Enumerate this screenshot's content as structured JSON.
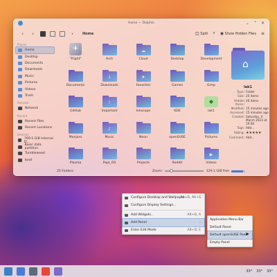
{
  "window": {
    "title": "Home — Dolphin",
    "controls": [
      "⌄",
      "⌃",
      "✕"
    ]
  },
  "toolbar": {
    "back": "‹",
    "forward": "›",
    "breadcrumb_arrow": "›",
    "breadcrumb": "Home",
    "split_label": "Split",
    "search_icon": "⌕",
    "show_hidden_label": "Show Hidden Files",
    "menu_icon": "≡"
  },
  "sidebar": {
    "places_header": "Places",
    "places": [
      {
        "label": "Home",
        "icon": "home-icon"
      },
      {
        "label": "Desktop",
        "icon": "desktop-icon"
      },
      {
        "label": "Documents",
        "icon": "documents-icon"
      },
      {
        "label": "Downloads",
        "icon": "downloads-icon"
      },
      {
        "label": "Music",
        "icon": "music-icon"
      },
      {
        "label": "Pictures",
        "icon": "pictures-icon"
      },
      {
        "label": "Videos",
        "icon": "videos-icon"
      },
      {
        "label": "Trash",
        "icon": "trash-icon"
      }
    ],
    "remote_header": "Remote",
    "remote": [
      {
        "label": "Network",
        "icon": "network-icon"
      }
    ],
    "recent_header": "Recent",
    "recent": [
      {
        "label": "Recent Files",
        "icon": "recent-files-icon"
      },
      {
        "label": "Recent Locations",
        "icon": "recent-locations-icon"
      }
    ],
    "devices_header": "Devices",
    "devices": [
      {
        "label": "769.5 GiB Internal D...",
        "icon": "drive-icon"
      },
      {
        "label": "Basic data partition",
        "icon": "drive-icon"
      },
      {
        "label": "Tumbleweed",
        "icon": "drive-icon"
      },
      {
        "label": "boot",
        "icon": "drive-icon"
      }
    ]
  },
  "files": [
    {
      "name": "\"Flight\"",
      "kind": "image"
    },
    {
      "name": "Arch",
      "kind": "folder",
      "glyph": ""
    },
    {
      "name": "Cloud",
      "kind": "folder",
      "glyph": "☁"
    },
    {
      "name": "Desktop",
      "kind": "folder",
      "glyph": ""
    },
    {
      "name": "Development",
      "kind": "folder",
      "glyph": ""
    },
    {
      "name": "Documents",
      "kind": "folder",
      "glyph": ""
    },
    {
      "name": "Downloads",
      "kind": "folder",
      "glyph": "↓"
    },
    {
      "name": "Favorites",
      "kind": "folder",
      "glyph": "★"
    },
    {
      "name": "Games",
      "kind": "folder",
      "glyph": ""
    },
    {
      "name": "Gimp",
      "kind": "folder",
      "glyph": ""
    },
    {
      "name": "GitHub",
      "kind": "folder",
      "glyph": ""
    },
    {
      "name": "Important",
      "kind": "folder",
      "glyph": "!"
    },
    {
      "name": "Inkscape",
      "kind": "folder",
      "glyph": ""
    },
    {
      "name": "KDE",
      "kind": "folder",
      "glyph": ""
    },
    {
      "name": "lak1",
      "kind": "ghost"
    },
    {
      "name": "Manjaro",
      "kind": "folder",
      "glyph": ""
    },
    {
      "name": "Music",
      "kind": "folder",
      "glyph": "♪"
    },
    {
      "name": "Neon",
      "kind": "folder",
      "glyph": ""
    },
    {
      "name": "openSUSE",
      "kind": "folder",
      "glyph": ""
    },
    {
      "name": "Pictures",
      "kind": "folder",
      "glyph": ""
    },
    {
      "name": "Plasma",
      "kind": "folder",
      "glyph": ""
    },
    {
      "name": "PopI_OS",
      "kind": "folder",
      "glyph": ""
    },
    {
      "name": "Projects",
      "kind": "folder",
      "glyph": ""
    },
    {
      "name": "Reddit",
      "kind": "folder",
      "glyph": ""
    },
    {
      "name": "Videos",
      "kind": "folder",
      "glyph": "▶"
    }
  ],
  "info_panel": {
    "name": "lak1",
    "rows": [
      {
        "k": "Type:",
        "v": "Folder"
      },
      {
        "k": "Size:",
        "v": "25 items"
      },
      {
        "k": "Hidden Items:",
        "v": "26 items"
      },
      {
        "k": "Modified:",
        "v": "15 minutes ago"
      },
      {
        "k": "Accessed:",
        "v": "15 minutes ago"
      },
      {
        "k": "Created:",
        "v": "Saturday, 4 March 2023 at 19:36"
      },
      {
        "k": "Tags:",
        "v": "Add..."
      }
    ],
    "rating_label": "Rating:",
    "rating_stars": "★★★★★",
    "comment_label": "Comment:",
    "comment_value": "Add..."
  },
  "statusbar": {
    "folders": "25 Folders",
    "zoom_label": "Zoom:",
    "free": "129.1 GiB free",
    "free_used_fraction": 0.85
  },
  "context_menu": [
    {
      "label": "Configure Desktop and Wallpaper...",
      "shortcut": "Alt+D, Alt+S",
      "icon": "wallpaper-icon"
    },
    {
      "label": "Configure Display Settings...",
      "shortcut": "",
      "icon": "display-icon"
    },
    {
      "sep": true
    },
    {
      "label": "Add Widgets...",
      "shortcut": "Alt+D, A",
      "icon": "add-icon"
    },
    {
      "label": "Add Panel",
      "shortcut": "›",
      "icon": "add-icon",
      "highlight": true
    },
    {
      "label": "Enter Edit Mode",
      "shortcut": "Alt+D, E",
      "icon": "edit-icon"
    }
  ],
  "submenu": [
    {
      "label": "Application Menu Bar"
    },
    {
      "label": "Default Panel"
    },
    {
      "label": "Default openSUSE Panel",
      "highlight": true
    },
    {
      "label": "Empty Panel"
    }
  ],
  "taskbar": {
    "apps": [
      {
        "name": "launcher",
        "color": "#3f7fc4"
      },
      {
        "name": "dolphin",
        "color": "#4a7bd6"
      },
      {
        "name": "discover",
        "color": "#5e6a7a"
      },
      {
        "name": "store",
        "color": "#e6473a"
      },
      {
        "name": "settings",
        "color": "#7b6ac8"
      }
    ],
    "temps": [
      "33°",
      "33°",
      "33°"
    ]
  }
}
